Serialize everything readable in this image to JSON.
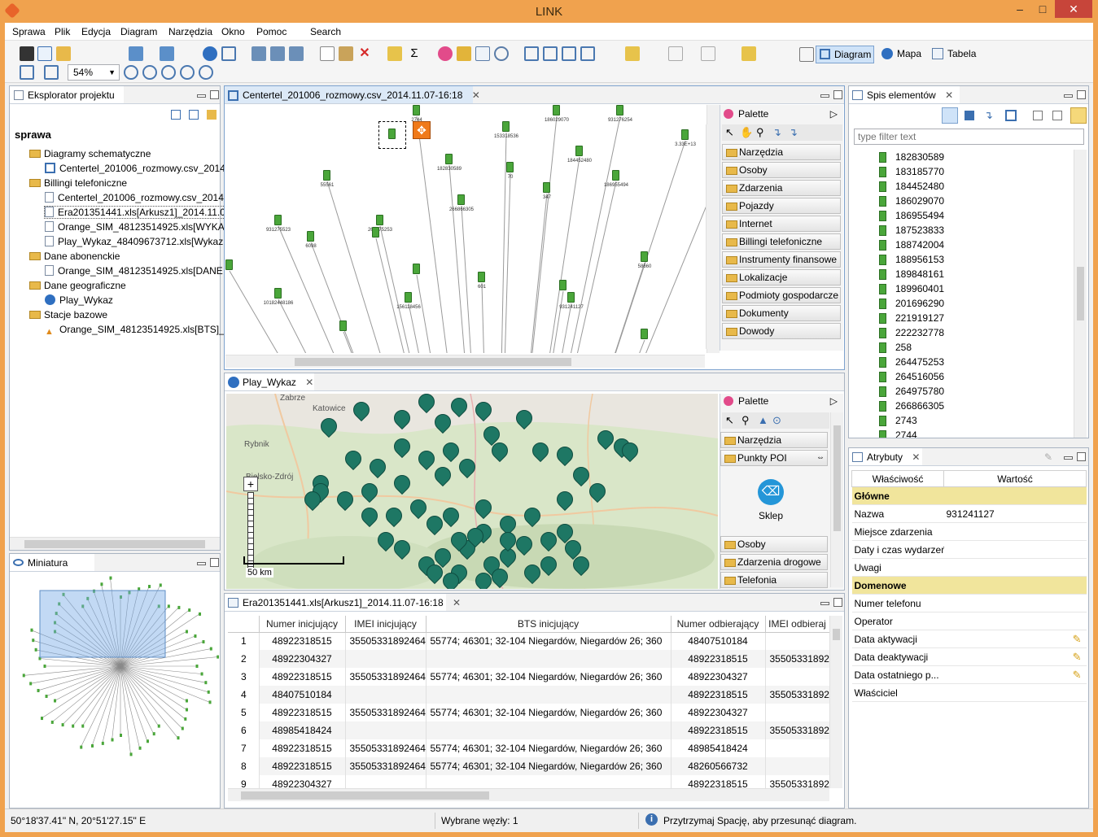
{
  "app": {
    "title": "LINK"
  },
  "menu": [
    "Sprawa",
    "Plik",
    "Edycja",
    "Diagram",
    "Narzędzia",
    "Okno",
    "Pomoc",
    "Search"
  ],
  "toolbar": {
    "zoom": "54%",
    "views": [
      "Diagram",
      "Mapa",
      "Tabela"
    ],
    "active_view": "Diagram"
  },
  "explorer": {
    "tab": "Eksplorator projektu",
    "root": "sprawa",
    "items": [
      {
        "label": "Diagramy schematyczne",
        "kind": "folder",
        "level": 1
      },
      {
        "label": "Centertel_201006_rozmowy.csv_2014",
        "kind": "diagram",
        "level": 2
      },
      {
        "label": "Billingi telefoniczne",
        "kind": "folder",
        "level": 1
      },
      {
        "label": "Centertel_201006_rozmowy.csv_2014",
        "kind": "doc",
        "level": 2
      },
      {
        "label": "Era201351441.xls[Arkusz1]_2014.11.07",
        "kind": "doc",
        "level": 2
      },
      {
        "label": "Orange_SIM_48123514925.xls[WYKAZ",
        "kind": "doc",
        "level": 2
      },
      {
        "label": "Play_Wykaz_48409673712.xls[Wykaz p",
        "kind": "doc",
        "level": 2
      },
      {
        "label": "Dane abonenckie",
        "kind": "folder",
        "level": 1
      },
      {
        "label": "Orange_SIM_48123514925.xls[DANE (",
        "kind": "doc",
        "level": 2
      },
      {
        "label": "Dane geograficzne",
        "kind": "folder",
        "level": 1
      },
      {
        "label": "Play_Wykaz",
        "kind": "globe",
        "level": 2
      },
      {
        "label": "Stacje bazowe",
        "kind": "folder",
        "level": 1
      },
      {
        "label": "Orange_SIM_48123514925.xls[BTS]_20",
        "kind": "antenna",
        "level": 2
      }
    ]
  },
  "miniature": {
    "tab": "Miniatura"
  },
  "diagram_editor": {
    "tab": "Centertel_201006_rozmowy.csv_2014.11.07-16:18",
    "palette_title": "Palette",
    "palette": [
      "Narzędzia",
      "Osoby",
      "Zdarzenia",
      "Pojazdy",
      "Internet",
      "Billingi telefoniczne",
      "Instrumenty finansowe",
      "Lokalizacje",
      "Podmioty gospodarcze",
      "Dokumenty",
      "Dowody"
    ],
    "node_labels": [
      "2744",
      "186029070",
      "931276254",
      "182830589",
      "153318536",
      "184452480",
      "3.33E+13",
      "186955494",
      "347",
      "266866305",
      "264475253",
      "931275523",
      "6098",
      "55561",
      "58660",
      "10182448186",
      "156118456",
      "601",
      "70",
      "931241127"
    ]
  },
  "map_editor": {
    "tab": "Play_Wykaz",
    "palette_title": "Palette",
    "palette_top": [
      "Narzędzia"
    ],
    "poi_group": "Punkty POI",
    "poi_item": "Sklep",
    "palette_bottom": [
      "Osoby",
      "Zdarzenia drogowe",
      "Telefonia"
    ],
    "scale": "50 km",
    "places": [
      "Zabrze",
      "Katowice",
      "Rybnik",
      "Bielsko-Zdrój"
    ]
  },
  "table_editor": {
    "tab": "Era201351441.xls[Arkusz1]_2014.11.07-16:18",
    "columns": [
      "",
      "Numer inicjujący",
      "IMEI inicjujący",
      "BTS inicjujący",
      "Numer odbierający",
      "IMEI odbieraj"
    ],
    "rows": [
      [
        "1",
        "48922318515",
        "35505331892464",
        "55774; 46301; 32-104 Niegardów, Niegardów 26; 360",
        "48407510184",
        ""
      ],
      [
        "2",
        "48922304327",
        "",
        "",
        "48922318515",
        "35505331892464"
      ],
      [
        "3",
        "48922318515",
        "35505331892464",
        "55774; 46301; 32-104 Niegardów, Niegardów 26; 360",
        "48922304327",
        ""
      ],
      [
        "4",
        "48407510184",
        "",
        "",
        "48922318515",
        "35505331892464"
      ],
      [
        "5",
        "48922318515",
        "35505331892464",
        "55774; 46301; 32-104 Niegardów, Niegardów 26; 360",
        "48922304327",
        ""
      ],
      [
        "6",
        "48985418424",
        "",
        "",
        "48922318515",
        "35505331892464"
      ],
      [
        "7",
        "48922318515",
        "35505331892464",
        "55774; 46301; 32-104 Niegardów, Niegardów 26; 360",
        "48985418424",
        ""
      ],
      [
        "8",
        "48922318515",
        "35505331892464",
        "55774; 46301; 32-104 Niegardów, Niegardów 26; 360",
        "48260566732",
        ""
      ],
      [
        "9",
        "48922304327",
        "",
        "",
        "48922318515",
        "35505331892464"
      ]
    ]
  },
  "elements": {
    "tab": "Spis elementów",
    "filter_placeholder": "type filter text",
    "items": [
      "182830589",
      "183185770",
      "184452480",
      "186029070",
      "186955494",
      "187523833",
      "188742004",
      "188956153",
      "189848161",
      "189960401",
      "201696290",
      "221919127",
      "222232778",
      "258",
      "264475253",
      "264516056",
      "264975780",
      "266866305",
      "2743",
      "2744"
    ]
  },
  "attributes": {
    "tab": "Atrybuty",
    "headers": [
      "Właściwość",
      "Wartość"
    ],
    "rows": [
      {
        "name": "Główne",
        "value": "",
        "section": true
      },
      {
        "name": "Nazwa",
        "value": "931241127"
      },
      {
        "name": "Miejsce zdarzenia",
        "value": ""
      },
      {
        "name": "Daty i czas wydarzeń",
        "value": ""
      },
      {
        "name": "Uwagi",
        "value": ""
      },
      {
        "name": "Domenowe",
        "value": "",
        "section": true
      },
      {
        "name": "Numer telefonu",
        "value": ""
      },
      {
        "name": "Operator",
        "value": ""
      },
      {
        "name": "Data aktywacji",
        "value": "",
        "edit": true
      },
      {
        "name": "Data deaktywacji",
        "value": "",
        "edit": true
      },
      {
        "name": "Data ostatniego p...",
        "value": "",
        "edit": true
      },
      {
        "name": "Właściciel",
        "value": ""
      }
    ]
  },
  "status": {
    "coords": "50°18'37.41\" N, 20°51'27.15\" E",
    "selected": "Wybrane węzły: 1",
    "hint": "Przytrzymaj Spację, aby przesunąć diagram."
  },
  "colors": {
    "window_frame": "#f0a24e",
    "map_pin": "#1e7764",
    "node": "#4aa63a",
    "section": "#f1e59c",
    "active_view": "#cfe3f8"
  }
}
